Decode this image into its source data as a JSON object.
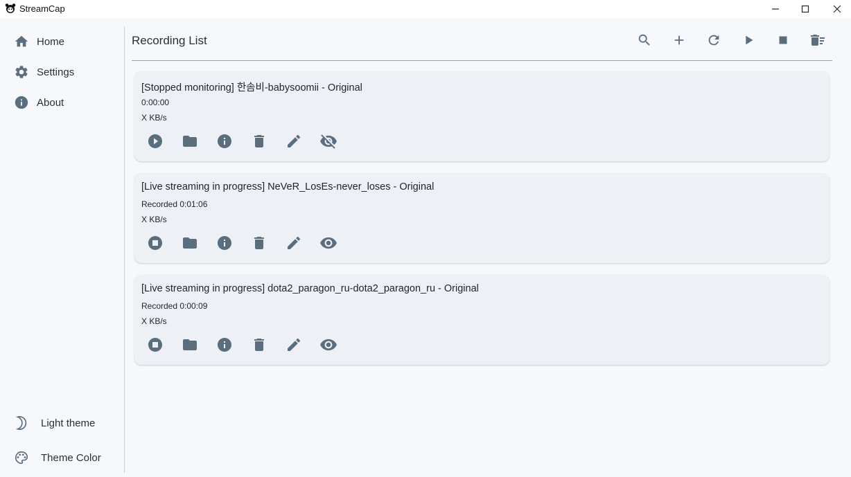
{
  "window": {
    "title": "StreamCap",
    "icon": "panda-app-icon"
  },
  "sidebar": {
    "items": [
      {
        "label": "Home",
        "icon": "home-icon"
      },
      {
        "label": "Settings",
        "icon": "gear-icon"
      },
      {
        "label": "About",
        "icon": "info-icon"
      }
    ],
    "bottom": [
      {
        "label": "Light theme",
        "icon": "moon-icon"
      },
      {
        "label": "Theme Color",
        "icon": "palette-icon"
      }
    ]
  },
  "main": {
    "title": "Recording List",
    "toolbar": [
      "search-icon",
      "add-icon",
      "refresh-icon",
      "play-icon",
      "stop-icon",
      "delete-sweep-icon"
    ],
    "recordings": [
      {
        "title": "[Stopped monitoring] 한솜비-babysoomii - Original",
        "duration": "0:00:00",
        "speed": "X KB/s",
        "primary_action": "play-circle-icon",
        "visibility_icon": "eye-off-icon"
      },
      {
        "title": "[Live streaming in progress] NeVeR_LosEs-never_loses - Original",
        "duration": "Recorded 0:01:06",
        "speed": "X KB/s",
        "primary_action": "stop-circle-icon",
        "visibility_icon": "eye-icon"
      },
      {
        "title": "[Live streaming in progress] dota2_paragon_ru-dota2_paragon_ru - Original",
        "duration": "Recorded 0:00:09",
        "speed": "X KB/s",
        "primary_action": "stop-circle-icon",
        "visibility_icon": "eye-icon"
      }
    ]
  },
  "colors": {
    "background": "#f6f8fc",
    "card": "#edf0f5",
    "icon": "#5a6e7e",
    "text": "#1f2328"
  }
}
